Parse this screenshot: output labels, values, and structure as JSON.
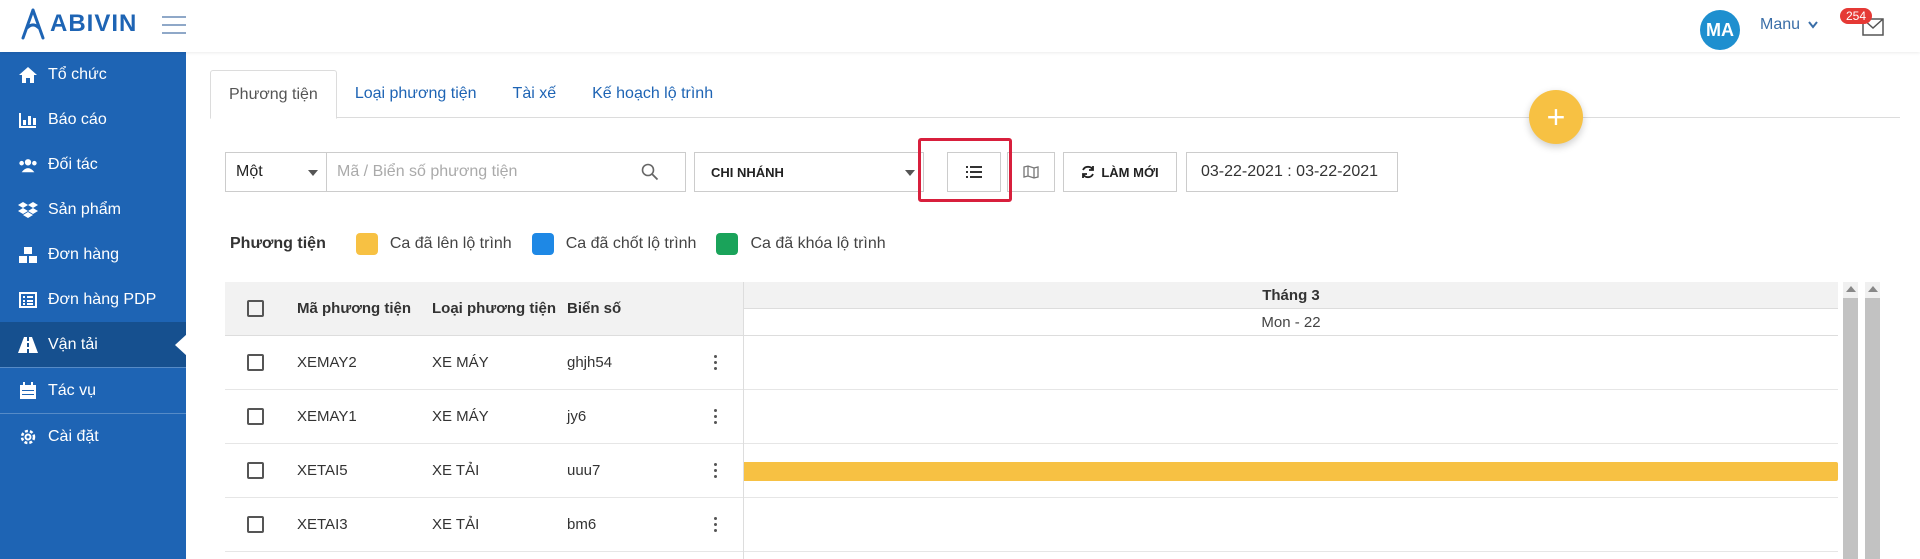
{
  "header": {
    "logo_text": "ABIVIN",
    "avatar_initials": "MA",
    "user_name": "Manu",
    "notification_count": "254"
  },
  "sidebar": {
    "items": [
      {
        "label": "Tổ chức",
        "icon": "home-icon"
      },
      {
        "label": "Báo cáo",
        "icon": "bar-chart-icon"
      },
      {
        "label": "Đối tác",
        "icon": "users-icon"
      },
      {
        "label": "Sản phẩm",
        "icon": "dropbox-icon"
      },
      {
        "label": "Đơn hàng",
        "icon": "cubes-icon"
      },
      {
        "label": "Đơn hàng PDP",
        "icon": "list-alt-icon"
      },
      {
        "label": "Vận tải",
        "icon": "road-icon",
        "active": true
      },
      {
        "label": "Tác vụ",
        "icon": "calendar-icon"
      },
      {
        "label": "Cài đặt",
        "icon": "gear-icon"
      }
    ]
  },
  "tabs": [
    {
      "label": "Phương tiện",
      "active": true
    },
    {
      "label": "Loại phương tiện"
    },
    {
      "label": "Tài xế"
    },
    {
      "label": "Kế hoạch lộ trình"
    }
  ],
  "toolbar": {
    "mode_select": "Một",
    "search_placeholder": "Mã / Biển số phương tiện",
    "branch_select": "CHI NHÁNH",
    "refresh_label": "LÀM MỚI",
    "date_range": "03-22-2021 : 03-22-2021"
  },
  "legend": {
    "title": "Phương tiện",
    "items": [
      {
        "label": "Ca đã lên lộ trình",
        "color": "#f7c143"
      },
      {
        "label": "Ca đã chốt lộ trình",
        "color": "#1e88e5"
      },
      {
        "label": "Ca đã khóa lộ trình",
        "color": "#1aa35a"
      }
    ]
  },
  "table": {
    "columns": [
      "Mã phương tiện",
      "Loại phương tiện",
      "Biển số"
    ],
    "rows": [
      [
        "XEMAY2",
        "XE MÁY",
        "ghjh54"
      ],
      [
        "XEMAY1",
        "XE MÁY",
        "jy6"
      ],
      [
        "XETAI5",
        "XE TẢI",
        "uuu7"
      ],
      [
        "XETAI3",
        "XE TẢI",
        "bm6"
      ]
    ]
  },
  "timeline": {
    "month": "Tháng 3",
    "day": "Mon - 22"
  },
  "colors": {
    "sidebar_bg": "#1e64b4",
    "accent": "#1e64b4",
    "fab": "#f7c143",
    "highlight": "#d81f3c"
  }
}
